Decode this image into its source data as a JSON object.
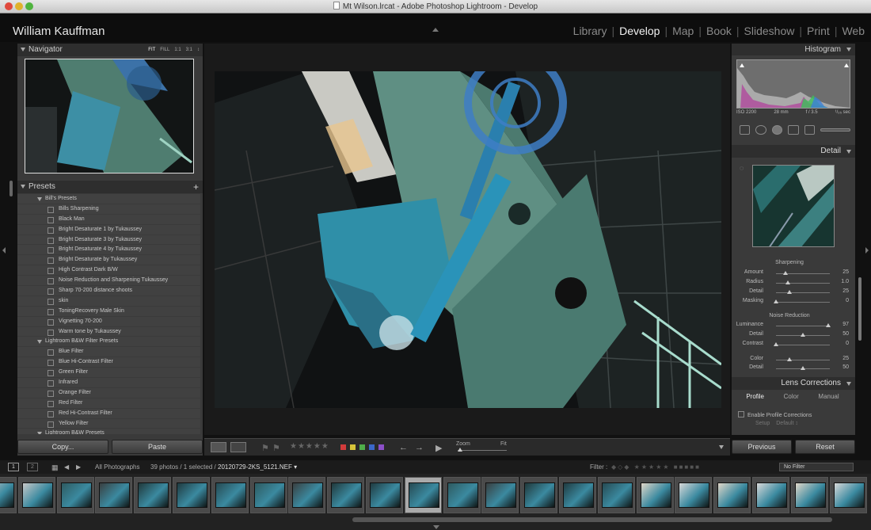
{
  "window": {
    "title": "Mt Wilson.lrcat - Adobe Photoshop Lightroom - Develop"
  },
  "identity_plate": "William Kauffman",
  "modules": [
    {
      "label": "Library",
      "active": false
    },
    {
      "label": "Develop",
      "active": true
    },
    {
      "label": "Map",
      "active": false
    },
    {
      "label": "Book",
      "active": false
    },
    {
      "label": "Slideshow",
      "active": false
    },
    {
      "label": "Print",
      "active": false
    },
    {
      "label": "Web",
      "active": false
    }
  ],
  "navigator": {
    "title": "Navigator",
    "options": [
      "FIT",
      "FILL",
      "1:1",
      "3:1"
    ],
    "more": "↕"
  },
  "presets": {
    "title": "Presets",
    "add": "+",
    "rows": [
      {
        "type": "folder",
        "label": "Bill's Presets"
      },
      {
        "type": "item",
        "label": "Bills Sharpening"
      },
      {
        "type": "item",
        "label": "Black Man"
      },
      {
        "type": "item",
        "label": "Bright Desaturate 1 by Tukaussey"
      },
      {
        "type": "item",
        "label": "Bright Desaturate 3 by Tukaussey"
      },
      {
        "type": "item",
        "label": "Bright Desaturate 4 by Tukaussey"
      },
      {
        "type": "item",
        "label": "Bright Desaturate by Tukaussey"
      },
      {
        "type": "item",
        "label": "High Contrast Dark B/W"
      },
      {
        "type": "item",
        "label": "Noise Reduction and Sharpening Tukaussey"
      },
      {
        "type": "item",
        "label": "Sharp 70-200 distance shoots"
      },
      {
        "type": "item",
        "label": "skin"
      },
      {
        "type": "item",
        "label": "ToningRecovery Male Skin"
      },
      {
        "type": "item",
        "label": "Vignetting 70-200"
      },
      {
        "type": "item",
        "label": "Warm tone by Tukaussey"
      },
      {
        "type": "folder",
        "label": "Lightroom B&W Filter Presets"
      },
      {
        "type": "item",
        "label": "Blue Filter"
      },
      {
        "type": "item",
        "label": "Blue Hi-Contrast Filter"
      },
      {
        "type": "item",
        "label": "Green Filter"
      },
      {
        "type": "item",
        "label": "Infrared"
      },
      {
        "type": "item",
        "label": "Orange Filter"
      },
      {
        "type": "item",
        "label": "Red Filter"
      },
      {
        "type": "item",
        "label": "Red Hi-Contrast Filter"
      },
      {
        "type": "item",
        "label": "Yellow Filter"
      },
      {
        "type": "folder",
        "label": "Lightroom B&W Presets"
      }
    ]
  },
  "left_buttons": {
    "copy": "Copy...",
    "paste": "Paste"
  },
  "toolbar": {
    "stars": "★★★★★",
    "color_labels": [
      "#d23b3b",
      "#d6c43a",
      "#4fae4a",
      "#3b67c8",
      "#8c4fc8"
    ],
    "zoom_label": "Zoom",
    "zoom_value": "Fit",
    "prev_arrow": "←",
    "next_arrow": "→",
    "play": "▶"
  },
  "histogram": {
    "title": "Histogram",
    "iso": "ISO 2200",
    "focal": "28 mm",
    "aperture": "f / 3.5",
    "shutter": "¹/₂₅ sec"
  },
  "detail": {
    "title": "Detail",
    "sharpening_title": "Sharpening",
    "sharpening": [
      {
        "label": "Amount",
        "value": "25",
        "level": 0.17
      },
      {
        "label": "Radius",
        "value": "1.0",
        "level": 0.22
      },
      {
        "label": "Detail",
        "value": "25",
        "level": 0.25
      },
      {
        "label": "Masking",
        "value": "0",
        "level": 0.0
      }
    ],
    "noise_title": "Noise Reduction",
    "noise": [
      {
        "label": "Luminance",
        "value": "97",
        "level": 0.97
      },
      {
        "label": "Detail",
        "value": "50",
        "level": 0.5
      },
      {
        "label": "Contrast",
        "value": "0",
        "level": 0.0
      },
      {
        "label": "Color",
        "value": "25",
        "level": 0.25
      },
      {
        "label": "Detail",
        "value": "50",
        "level": 0.5
      }
    ]
  },
  "lens": {
    "title": "Lens Corrections",
    "tabs": [
      {
        "label": "Profile",
        "active": true
      },
      {
        "label": "Color",
        "active": false
      },
      {
        "label": "Manual",
        "active": false
      }
    ],
    "checkbox": "Enable Profile Corrections",
    "setup_label": "Setup",
    "setup_value": "Default ↕"
  },
  "right_buttons": {
    "previous": "Previous",
    "reset": "Reset"
  },
  "filmbar": {
    "screen1": "1",
    "screen2": "2",
    "source": "All Photographs",
    "count": "39 photos / 1 selected /",
    "filename": "20120729-2KS_5121.NEF ▾",
    "filter_label": "Filter :",
    "filter_value": "No Filter"
  },
  "filmstrip": {
    "count": 23,
    "selected_index": 11
  }
}
